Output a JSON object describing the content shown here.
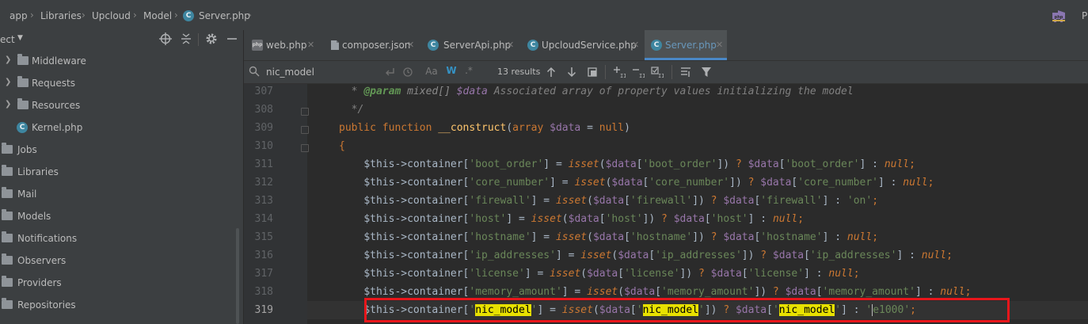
{
  "breadcrumb": [
    "app",
    "Libraries",
    "Upcloud",
    "Model",
    "Server.php"
  ],
  "header_right_letter": "P",
  "sidebar": {
    "project_label": "ect",
    "items": [
      {
        "label": "Middleware",
        "expandable": true
      },
      {
        "label": "Requests",
        "expandable": true
      },
      {
        "label": "Resources",
        "expandable": true
      },
      {
        "label": "Kernel.php",
        "expandable": false,
        "icon": "class-file-icon"
      },
      {
        "label": "Jobs",
        "expandable": false
      },
      {
        "label": "Libraries",
        "expandable": false
      },
      {
        "label": "Mail",
        "expandable": false
      },
      {
        "label": "Models",
        "expandable": false
      },
      {
        "label": "Notifications",
        "expandable": false
      },
      {
        "label": "Observers",
        "expandable": false
      },
      {
        "label": "Providers",
        "expandable": false
      },
      {
        "label": "Repositories",
        "expandable": false
      }
    ]
  },
  "tabs": [
    {
      "label": "web.php",
      "icon": "php-file-icon",
      "active": false
    },
    {
      "label": "composer.json",
      "icon": "json-file-icon",
      "active": false
    },
    {
      "label": "ServerApi.php",
      "icon": "class-file-icon",
      "active": false
    },
    {
      "label": "UpcloudService.php",
      "icon": "class-file-icon",
      "active": false
    },
    {
      "label": "Server.php",
      "icon": "class-file-icon",
      "active": true
    }
  ],
  "search": {
    "value": "nic_model",
    "results": "13 results",
    "match_case": "Aa",
    "words": "W"
  },
  "editor": {
    "lines": [
      "307",
      "308",
      "309",
      "310",
      "311",
      "312",
      "313",
      "314",
      "315",
      "316",
      "317",
      "318",
      "319"
    ],
    "current_line": "319"
  },
  "colors": {
    "background": "#2b2b2b",
    "keyword": "#cc7832",
    "string": "#6a8759",
    "variable": "#9876aa",
    "function": "#ffc66d",
    "highlight": "#e8e100",
    "annotation_box": "#e8161b"
  }
}
